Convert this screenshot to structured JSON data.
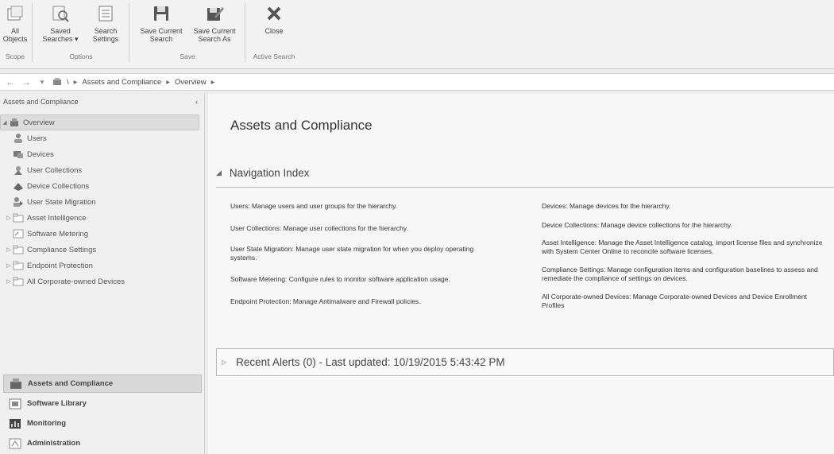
{
  "ribbon": {
    "buttons": {
      "all_objects": "All\nObjects",
      "saved_searches": "Saved\nSearches ▾",
      "search_settings": "Search\nSettings",
      "save_current_search": "Save Current\nSearch",
      "save_current_search_as": "Save Current\nSearch As",
      "close": "Close"
    },
    "groups": {
      "scope": "Scope",
      "options": "Options",
      "save": "Save",
      "active_search": "Active Search"
    }
  },
  "address": {
    "back": "←",
    "forward": "→",
    "dropdown": "▾",
    "root": "\\",
    "path1": "Assets and Compliance",
    "path2": "Overview",
    "sep": "▸"
  },
  "leftnav": {
    "title": "Assets and Compliance",
    "collapse": "‹",
    "tree": [
      {
        "label": "Overview",
        "icon": "overview-icon"
      },
      {
        "label": "Users",
        "icon": "user-icon"
      },
      {
        "label": "Devices",
        "icon": "devices-icon"
      },
      {
        "label": "User Collections",
        "icon": "user-collection-icon"
      },
      {
        "label": "Device Collections",
        "icon": "device-collection-icon"
      },
      {
        "label": "User State Migration",
        "icon": "migration-icon"
      },
      {
        "label": "Asset Intelligence",
        "icon": "folder-icon"
      },
      {
        "label": "Software Metering",
        "icon": "metering-icon"
      },
      {
        "label": "Compliance Settings",
        "icon": "folder-icon"
      },
      {
        "label": "Endpoint Protection",
        "icon": "folder-icon"
      },
      {
        "label": "All Corporate-owned Devices",
        "icon": "folder-icon"
      }
    ],
    "workspaces": [
      {
        "label": "Assets and Compliance",
        "icon": "assets-workspace-icon"
      },
      {
        "label": "Software Library",
        "icon": "software-library-icon"
      },
      {
        "label": "Monitoring",
        "icon": "monitoring-icon"
      },
      {
        "label": "Administration",
        "icon": "administration-icon"
      }
    ]
  },
  "main": {
    "title": "Assets and Compliance",
    "nav_index_title": "Navigation Index",
    "left_items": [
      "Users: Manage users and user groups for the hierarchy.",
      "User Collections: Manage user collections for the hierarchy.",
      "User State Migration: Manage user state migration for when you deploy operating systems.",
      "Software Metering: Configure rules to monitor software application usage.",
      "Endpoint Protection: Manage Antimalware and Firewall policies."
    ],
    "right_items": [
      "Devices: Manage devices for the hierarchy.",
      "Device Collections: Manage device collections for the hierarchy.",
      "Asset Intelligence: Manage the Asset Intelligence catalog, import license files and synchronize with System Center Online to reconcile software licenses.",
      "Compliance Settings: Manage configuration items and configuration baselines to assess and remediate the compliance of settings on devices.",
      "All Corporate-owned Devices: Manage Corporate-owned Devices and Device Enrollment Profiles"
    ],
    "alerts": "Recent Alerts (0) - Last updated: 10/19/2015 5:43:42 PM"
  }
}
